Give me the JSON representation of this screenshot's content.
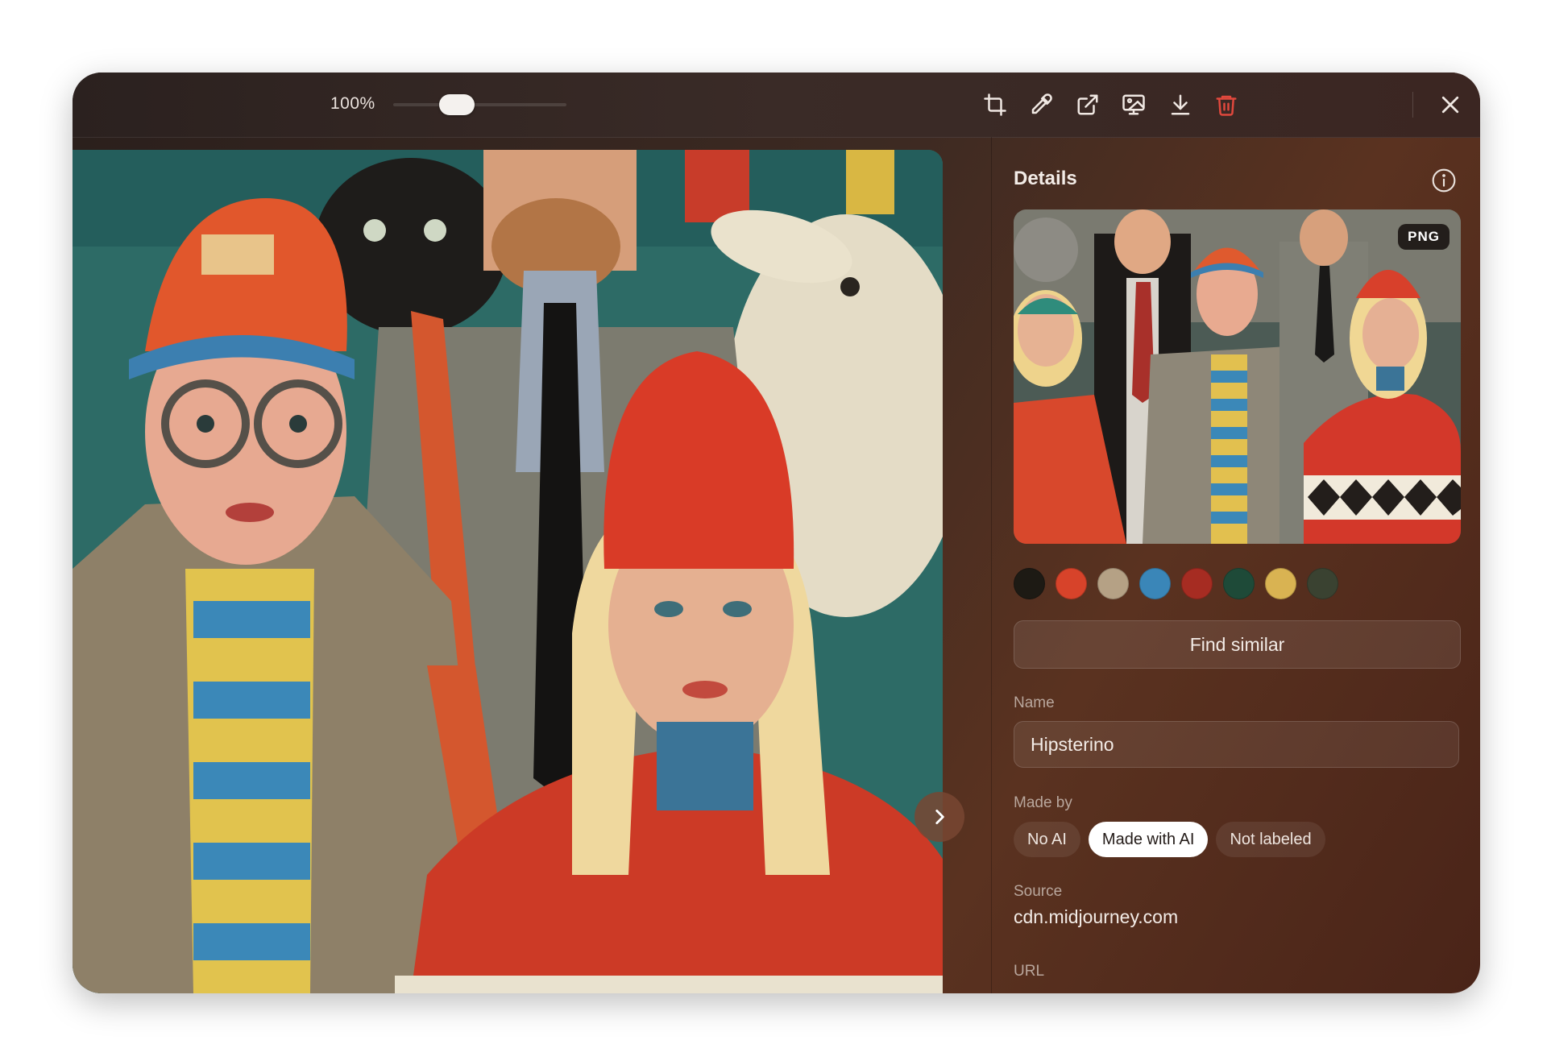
{
  "toolbar": {
    "zoom_label": "100%",
    "zoom_level_percent": 100,
    "icons": [
      "crop-icon",
      "eyedropper-icon",
      "open-external-icon",
      "set-wallpaper-icon",
      "download-icon",
      "trash-icon",
      "close-icon"
    ],
    "delete_color": "#e0483d"
  },
  "viewer": {
    "next_icon": "chevron-right-icon"
  },
  "details": {
    "title": "Details",
    "info_icon": "info-icon",
    "format_badge": "PNG",
    "palette": [
      "#1d1a14",
      "#d7432a",
      "#b5a185",
      "#3a86b8",
      "#a62c22",
      "#1e4a38",
      "#d9b352",
      "#3a4231"
    ],
    "find_similar_label": "Find similar",
    "name_label": "Name",
    "name_value": "Hipsterino",
    "made_by_label": "Made by",
    "made_by_options": [
      "No AI",
      "Made with AI",
      "Not labeled"
    ],
    "made_by_selected": "Made with AI",
    "source_label": "Source",
    "source_value": "cdn.midjourney.com",
    "url_label": "URL"
  }
}
